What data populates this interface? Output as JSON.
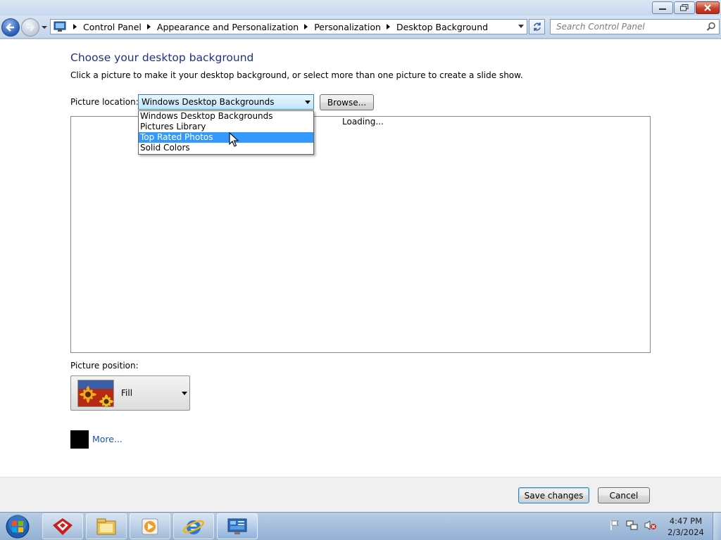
{
  "window": {
    "buttons": {
      "minimize": "minimize",
      "maximize": "maximize",
      "close": "close"
    }
  },
  "address_bar": {
    "breadcrumbs": [
      "Control Panel",
      "Appearance and Personalization",
      "Personalization",
      "Desktop Background"
    ],
    "search_placeholder": "Search Control Panel"
  },
  "main": {
    "title": "Choose your desktop background",
    "description": "Click a picture to make it your desktop background, or select more than one picture to create a slide show.",
    "picture_location_label": "Picture location:",
    "picture_location_value": "Windows Desktop Backgrounds",
    "browse_label": "Browse...",
    "loading_text": "Loading...",
    "dropdown_options": [
      "Windows Desktop Backgrounds",
      "Pictures Library",
      "Top Rated Photos",
      "Solid Colors"
    ],
    "dropdown_highlighted": "Top Rated Photos",
    "picture_position_label": "Picture position:",
    "picture_position_value": "Fill",
    "more_label": "More...",
    "color_swatch": "#000000"
  },
  "footer": {
    "save_label": "Save changes",
    "cancel_label": "Cancel"
  },
  "taskbar": {
    "time": "4:47 PM",
    "date": "2/3/2024",
    "apps": [
      "start-orb",
      "app-red-icon",
      "file-explorer-icon",
      "media-player-icon",
      "internet-explorer-icon",
      "control-panel-icon"
    ]
  },
  "colors": {
    "heading": "#1e3287",
    "link": "#1f50b4",
    "highlight": "#3399ff"
  }
}
